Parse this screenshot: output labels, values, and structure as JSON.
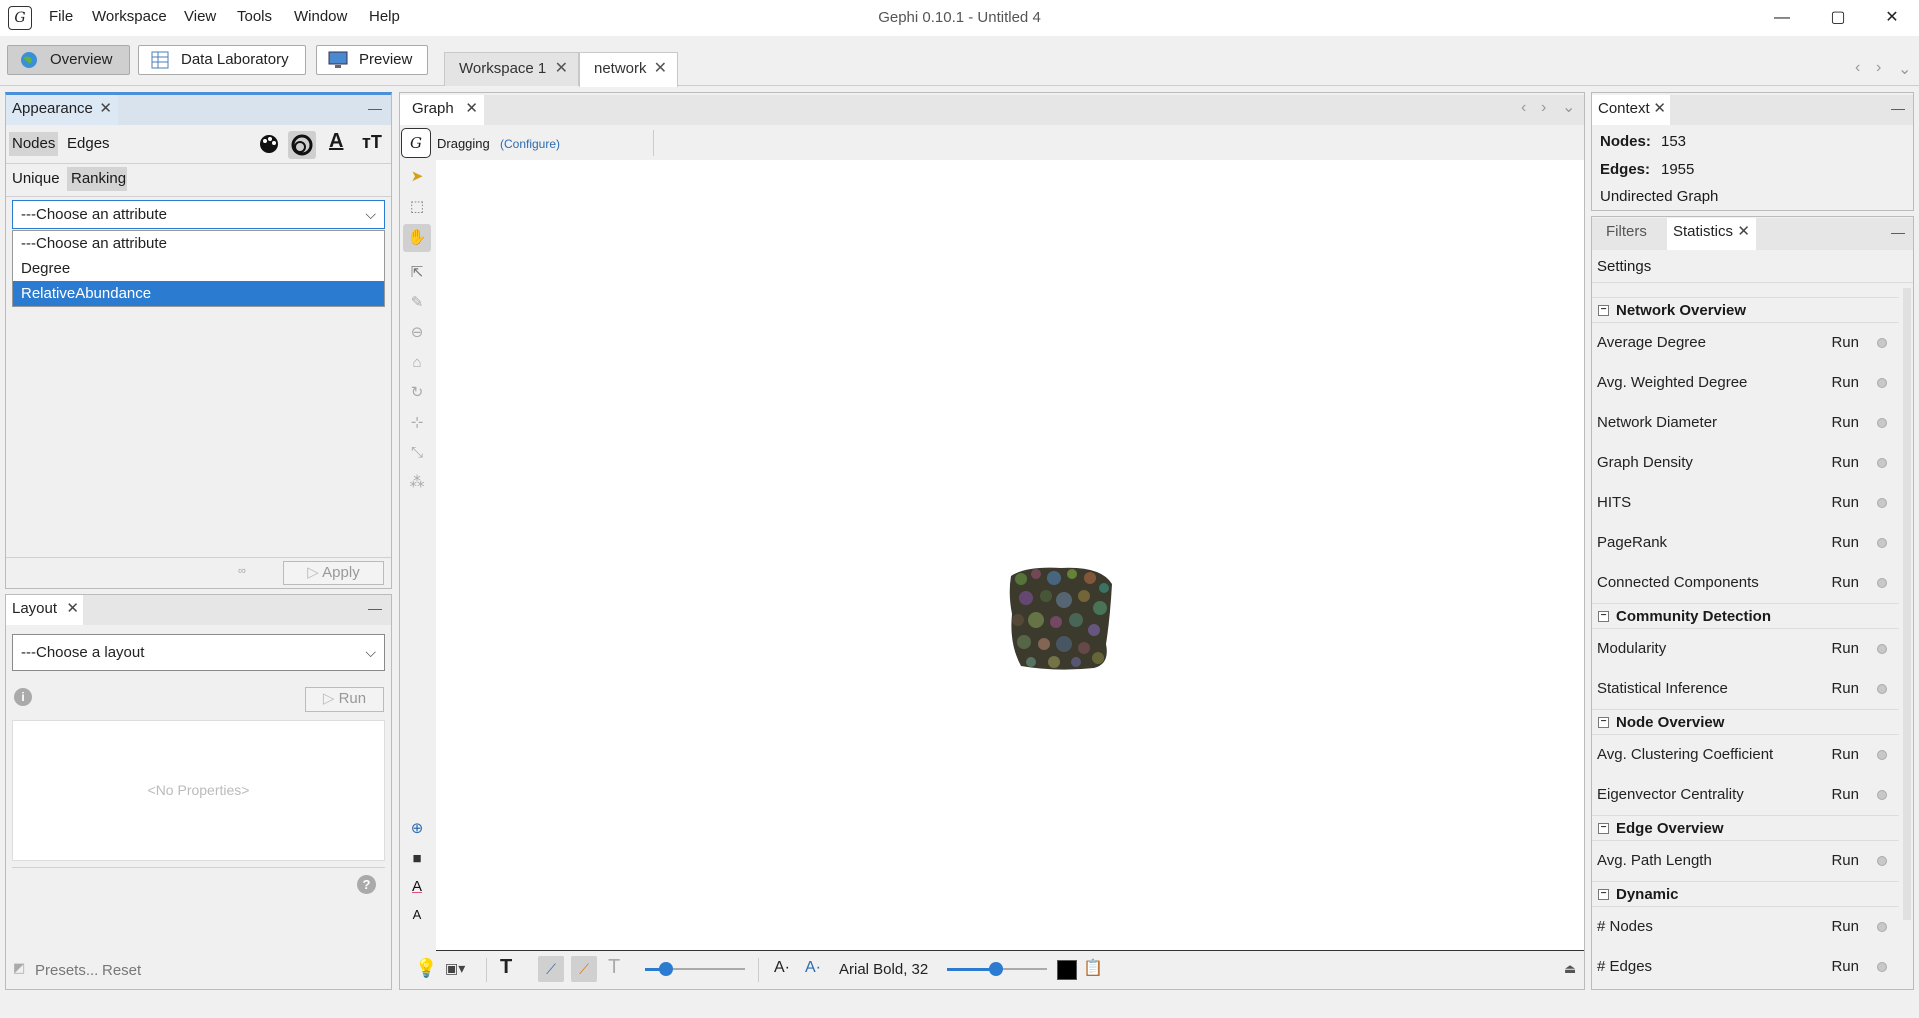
{
  "window": {
    "title": "Gephi 0.10.1 - Untitled 4",
    "minimize": "—",
    "maximize": "▢",
    "close": "✕"
  },
  "menu": [
    "File",
    "Workspace",
    "View",
    "Tools",
    "Window",
    "Help"
  ],
  "modes": {
    "overview": "Overview",
    "data_lab": "Data Laboratory",
    "preview": "Preview"
  },
  "workspace_tabs": [
    "Workspace 1",
    "network"
  ],
  "appearance": {
    "tab": "Appearance",
    "nodes": "Nodes",
    "edges": "Edges",
    "unique": "Unique",
    "ranking": "Ranking",
    "attribute_selected": "---Choose an attribute",
    "options": [
      "---Choose an attribute",
      "Degree",
      "RelativeAbundance"
    ],
    "apply": "Apply"
  },
  "layout": {
    "tab": "Layout",
    "selected": "---Choose a layout",
    "run": "Run",
    "no_props": "<No Properties>",
    "presets": "Presets...",
    "reset": "Reset"
  },
  "graph": {
    "tab": "Graph",
    "mode": "Dragging",
    "configure": "(Configure)",
    "font_label": "Arial Bold, 32",
    "edge_color": "#000000"
  },
  "context": {
    "tab": "Context",
    "nodes_label": "Nodes:",
    "nodes": "153",
    "edges_label": "Edges:",
    "edges": "1955",
    "type": "Undirected Graph"
  },
  "statistics": {
    "filters_tab": "Filters",
    "stats_tab": "Statistics",
    "settings": "Settings",
    "run": "Run",
    "groups": [
      {
        "title": "Network Overview",
        "items": [
          "Average Degree",
          "Avg. Weighted Degree",
          "Network Diameter",
          "Graph Density",
          "HITS",
          "PageRank",
          "Connected Components"
        ]
      },
      {
        "title": "Community Detection",
        "items": [
          "Modularity",
          "Statistical Inference"
        ]
      },
      {
        "title": "Node Overview",
        "items": [
          "Avg. Clustering Coefficient",
          "Eigenvector Centrality"
        ]
      },
      {
        "title": "Edge Overview",
        "items": [
          "Avg. Path Length"
        ]
      },
      {
        "title": "Dynamic",
        "items": [
          "# Nodes",
          "# Edges"
        ]
      }
    ]
  }
}
